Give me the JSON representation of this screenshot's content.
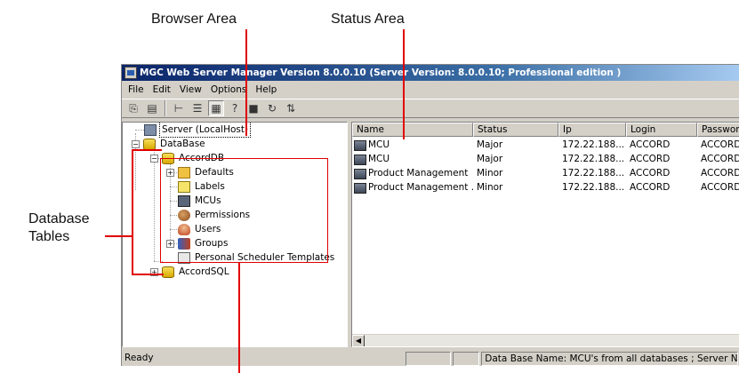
{
  "callouts": {
    "browser_area": "Browser Area",
    "status_area": "Status Area",
    "database_tables": [
      "Database",
      "Tables"
    ]
  },
  "window": {
    "title": "MGC Web Server Manager Version 8.0.0.10  (Server Version: 8.0.0.10;  Professional edition )"
  },
  "menu": [
    "File",
    "Edit",
    "View",
    "Options",
    "Help"
  ],
  "toolbar": {
    "buttons": [
      {
        "icon": "copy-icon",
        "glyph": "⎘"
      },
      {
        "icon": "paste-icon",
        "glyph": "▤"
      },
      {
        "icon": "tree-view-icon",
        "glyph": "⊢"
      },
      {
        "icon": "list-view-icon",
        "glyph": "☰"
      },
      {
        "icon": "details-view-icon",
        "glyph": "▦"
      },
      {
        "icon": "help-icon",
        "glyph": "?"
      },
      {
        "icon": "delete-icon",
        "glyph": "■"
      },
      {
        "icon": "refresh-icon",
        "glyph": "↻"
      },
      {
        "icon": "sort-icon",
        "glyph": "⇅"
      }
    ]
  },
  "tree": {
    "server": "Server (LocalHost)",
    "database": "DataBase",
    "accorddb": "AccordDB",
    "items": [
      "Defaults",
      "Labels",
      "MCUs",
      "Permissions",
      "Users",
      "Groups",
      "Personal Scheduler Templates"
    ],
    "accordsql": "AccordSQL"
  },
  "list": {
    "columns": [
      "Name",
      "Status",
      "Ip",
      "Login",
      "Password"
    ],
    "rows": [
      [
        "MCU",
        "Major",
        "172.22.188...",
        "ACCORD",
        "ACCORD"
      ],
      [
        "MCU",
        "Major",
        "172.22.188...",
        "ACCORD",
        "ACCORD"
      ],
      [
        "Product Management",
        "Minor",
        "172.22.188...",
        "ACCORD",
        "ACCORD"
      ],
      [
        "Product Management ...",
        "Minor",
        "172.22.188...",
        "ACCORD",
        "ACCORD"
      ]
    ]
  },
  "statusbar": {
    "ready": "Ready",
    "info": "Data Base Name: MCU's from all databases ; Server Name is:"
  }
}
